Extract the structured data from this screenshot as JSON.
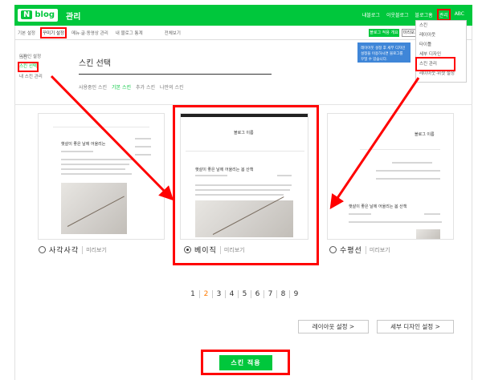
{
  "header": {
    "logo_text": "blog",
    "logo_n": "N",
    "title": "관리",
    "links": [
      "내블로그",
      "이웃블로그",
      "블로그홈",
      "관리",
      "ABC"
    ]
  },
  "tabs": [
    "기본 설정",
    "꾸미기 설정",
    "메뉴·글·동영상 관리",
    "내 블로그 통계",
    "전체보기"
  ],
  "tabbar_buttons": {
    "apply_top": "블로그 적용 개요",
    "preview_top": "미리보기"
  },
  "dropdown": {
    "items": [
      "스킨",
      "레이아웃",
      "타이틀",
      "세부 디자인",
      "스킨 관리",
      "레이아웃·위젯 설정"
    ],
    "tooltip": "레이아웃 설정 후 세부 디자인 설정을 이용하시면 블로그를 꾸밀 수 있습니다."
  },
  "sidenav": {
    "items": [
      "스킨",
      "스킨 선택",
      "내 스킨 관리"
    ],
    "small": "디자인 설정"
  },
  "page": {
    "title": "스킨 선택",
    "filters": [
      "사용중인 스킨",
      "기본 스킨",
      "추가 스킨",
      "나만의 스킨"
    ]
  },
  "cards": [
    {
      "name": "사각사각",
      "preview": "미리보기",
      "mock_title": "햇살이 좋은 날에 어울리는",
      "selected": false
    },
    {
      "name": "베이직",
      "preview": "미리보기",
      "mock_header": "블로그 이름",
      "mock_title": "햇살이 좋은 날에 어울리는 봄 산책",
      "selected": true
    },
    {
      "name": "수평선",
      "preview": "미리보기",
      "mock_header": "블로그 이름",
      "mock_title": "햇살이 좋은 날에 어울리는 봄 산책",
      "selected": false
    }
  ],
  "pagination": {
    "pages": [
      "1",
      "2",
      "3",
      "4",
      "5",
      "6",
      "7",
      "8",
      "9"
    ],
    "current": "2"
  },
  "buttons": {
    "layout": "레이아웃 설정 >",
    "design": "세부 디자인 설정 >",
    "apply": "스킨 적용"
  },
  "colors": {
    "accent": "#00c73c",
    "highlight": "#ff0000"
  }
}
